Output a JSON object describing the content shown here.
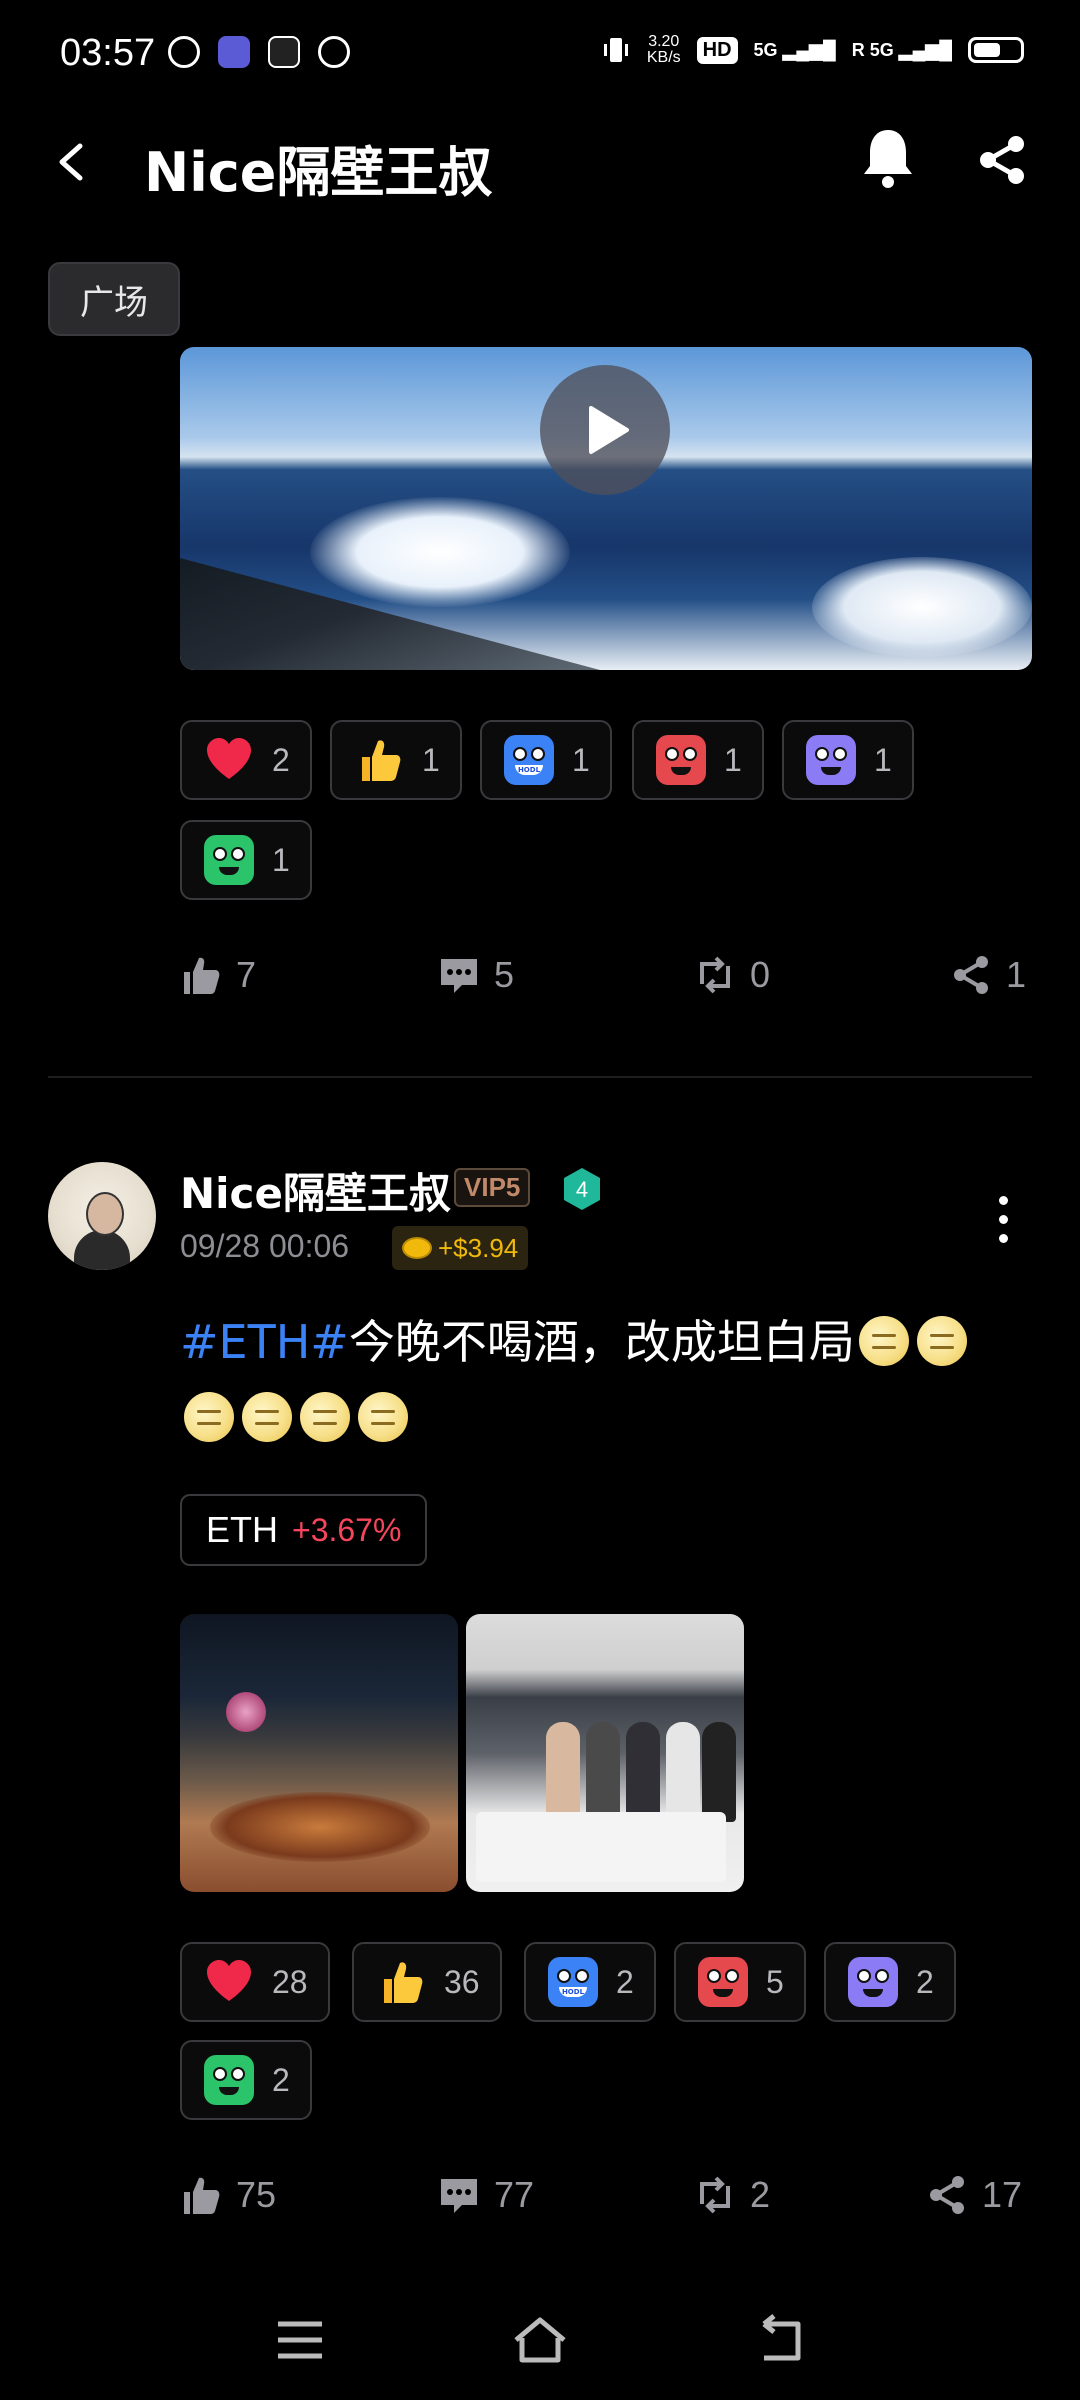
{
  "status_bar": {
    "time": "03:57",
    "net_speed_value": "3.20",
    "net_speed_unit": "KB/s",
    "hd": "HD",
    "signal1": "5G",
    "signal2": "5G",
    "roaming": "R"
  },
  "header": {
    "title": "Nice隔壁王叔"
  },
  "tag": "广场",
  "post1": {
    "reactions": [
      {
        "icon": "heart-icon",
        "count": "2"
      },
      {
        "icon": "thumbs-up-emoji",
        "count": "1"
      },
      {
        "icon": "hodl-emoji",
        "count": "1"
      },
      {
        "icon": "angry-emoji",
        "count": "1"
      },
      {
        "icon": "ghost-emoji",
        "count": "1"
      },
      {
        "icon": "sick-emoji",
        "count": "1"
      }
    ],
    "actions": {
      "likes": "7",
      "comments": "5",
      "reposts": "0",
      "shares": "1"
    }
  },
  "post2": {
    "username": "Nice隔壁王叔",
    "vip": "VIP5",
    "level": "4",
    "date": "09/28 00:06",
    "earnings": "+$3.94",
    "hashtag": "#ETH#",
    "text": "今晚不喝酒，改成坦白局",
    "coin_symbol": "ETH",
    "coin_change": "+3.67%",
    "reactions": [
      {
        "icon": "heart-icon",
        "count": "28"
      },
      {
        "icon": "thumbs-up-emoji",
        "count": "36"
      },
      {
        "icon": "hodl-emoji",
        "count": "2"
      },
      {
        "icon": "angry-emoji",
        "count": "5"
      },
      {
        "icon": "ghost-emoji",
        "count": "2"
      },
      {
        "icon": "sick-emoji",
        "count": "2"
      }
    ],
    "actions": {
      "likes": "75",
      "comments": "77",
      "reposts": "2",
      "shares": "17"
    }
  },
  "colors": {
    "background": "#000000",
    "hashtag": "#3b82f6",
    "gain": "#f6465d",
    "earn": "#f0b90b"
  }
}
